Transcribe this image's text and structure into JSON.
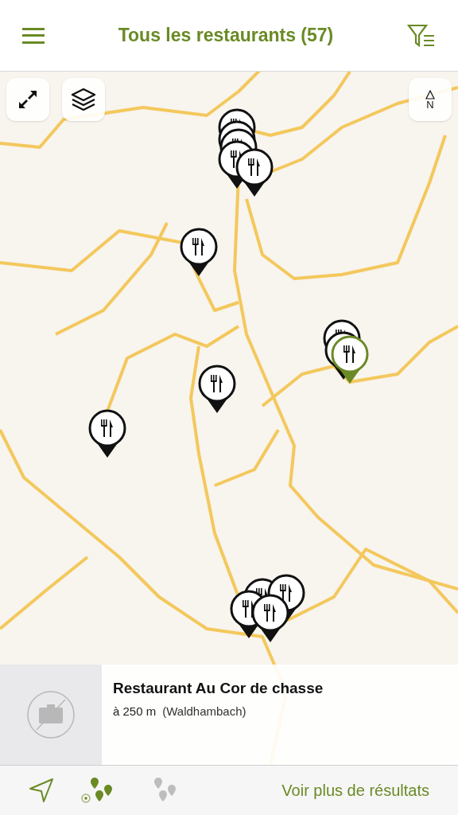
{
  "header": {
    "title": "Tous les restaurants (57)"
  },
  "map": {
    "compass_label": "N",
    "pin_groups": [
      {
        "pins": [
          {
            "selected": false
          },
          {
            "selected": false
          },
          {
            "selected": false
          },
          {
            "selected": false
          },
          {
            "selected": false
          }
        ]
      },
      {
        "pins": [
          {
            "selected": false
          }
        ]
      },
      {
        "pins": [
          {
            "selected": false
          },
          {
            "selected": false
          },
          {
            "selected": true
          }
        ]
      },
      {
        "pins": [
          {
            "selected": false
          }
        ]
      },
      {
        "pins": [
          {
            "selected": false
          }
        ]
      },
      {
        "pins": [
          {
            "selected": false
          },
          {
            "selected": false
          },
          {
            "selected": false
          },
          {
            "selected": false
          }
        ]
      }
    ]
  },
  "card": {
    "name": "Restaurant Au Cor de chasse",
    "distance": "à 250 m",
    "place": "(Waldhambach)"
  },
  "bottom_bar": {
    "view_modes": [
      {
        "kind": "nearby",
        "selected": true
      },
      {
        "kind": "all",
        "selected": false
      }
    ],
    "more_link": "Voir plus de résultats"
  }
}
